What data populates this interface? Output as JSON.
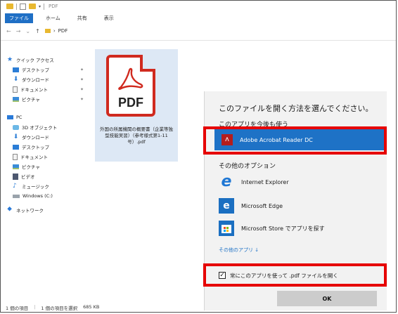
{
  "window": {
    "title": "PDF",
    "tabs": [
      "ファイル",
      "ホーム",
      "共有",
      "表示"
    ],
    "breadcrumb": [
      "PDF"
    ]
  },
  "nav": {
    "quick_access": "クイック アクセス",
    "quick_items": [
      "デスクトップ",
      "ダウンロード",
      "ドキュメント",
      "ピクチャ"
    ],
    "pc": "PC",
    "pc_items": [
      "3D オブジェクト",
      "ダウンロード",
      "デスクトップ",
      "ドキュメント",
      "ピクチャ",
      "ビデオ",
      "ミュージック",
      "Windows (C:)"
    ],
    "network": "ネットワーク"
  },
  "file": {
    "icon_label": "PDF",
    "name": "外国の所属機関の概要書（企業等独型技能実習）（参考様式第1-11号）.pdf"
  },
  "status_bar": {
    "items_count": "1 個の項目",
    "selected": "1 個の項目を選択",
    "size": "685 KB"
  },
  "dialog": {
    "title": "このファイルを開く方法を選んでください。",
    "keep_using_label": "このアプリを今後も使う",
    "selected_app": "Adobe Acrobat Reader DC",
    "other_options_label": "その他のオプション",
    "apps": [
      "Internet Explorer",
      "Microsoft Edge",
      "Microsoft Store でアプリを探す"
    ],
    "more_apps_link": "その他のアプリ ↓",
    "always_use_label": "常にこのアプリを使って .pdf ファイルを開く",
    "always_use_checked": true,
    "ok_label": "OK"
  },
  "colors": {
    "accent": "#1e72c6",
    "highlight_box": "#e60000",
    "pdf_red": "#d02a1f"
  }
}
